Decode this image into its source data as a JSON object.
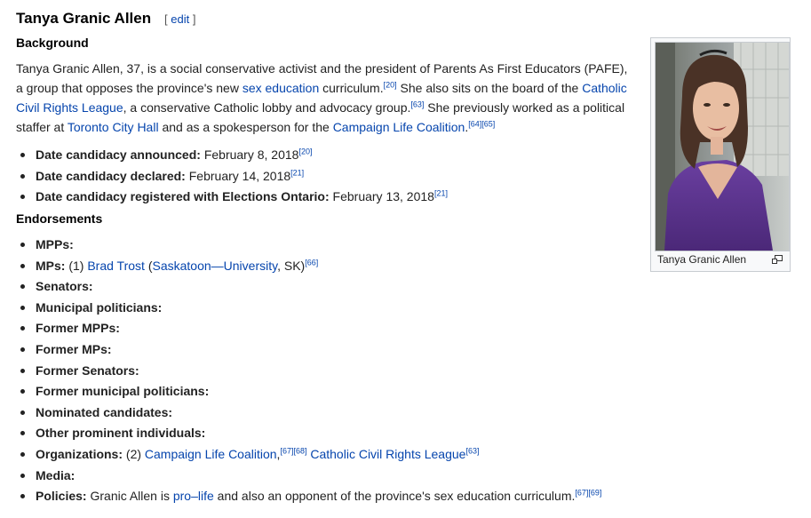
{
  "heading": {
    "title": "Tanya Granic Allen",
    "edit_open": "[",
    "edit_link": "edit",
    "edit_close": "]"
  },
  "background": {
    "heading": "Background",
    "p1": "Tanya Granic Allen, 37, is a social conservative activist and the president of Parents As First Educators (PAFE), a group that opposes the province's new ",
    "link_sex_ed": "sex education",
    "p2": " curriculum.",
    "ref1": "[20]",
    "p3": " She also sits on the board of the ",
    "link_ccrl": "Catholic Civil Rights League",
    "p4": ", a conservative Catholic lobby and advocacy group.",
    "ref2": "[63]",
    "p5": " She previously worked as a political staffer at ",
    "link_toronto": "Toronto City Hall",
    "p6": " and as a spokesperson for the ",
    "link_clc": "Campaign Life Coalition",
    "p7": ".",
    "ref3": "[64]",
    "ref4": "[65]"
  },
  "dates": [
    {
      "label": "Date candidacy announced:",
      "value": " February 8, 2018",
      "ref": "[20]"
    },
    {
      "label": "Date candidacy declared:",
      "value": " February 14, 2018",
      "ref": "[21]"
    },
    {
      "label": "Date candidacy registered with Elections Ontario:",
      "value": " February 13, 2018",
      "ref": "[21]"
    }
  ],
  "endorsements": {
    "heading": "Endorsements",
    "mpps": "MPPs:",
    "mps": {
      "label": "MPs:",
      "count": " (1) ",
      "link1": "Brad Trost",
      "paren_open": " (",
      "link2": "Saskatoon—University",
      "suffix": ", SK)",
      "ref": "[66]"
    },
    "senators": "Senators:",
    "municipal": "Municipal politicians:",
    "former_mpps": "Former MPPs:",
    "former_mps": "Former MPs:",
    "former_senators": "Former Senators:",
    "former_municipal": "Former municipal politicians:",
    "nominated": "Nominated candidates:",
    "other": "Other prominent individuals:",
    "orgs": {
      "label": "Organizations:",
      "count": " (2) ",
      "link1": "Campaign Life Coalition",
      "comma": ",",
      "ref1": "[67]",
      "ref2": "[68]",
      "space": " ",
      "link2": "Catholic Civil Rights League",
      "ref3": "[63]"
    },
    "media": "Media:",
    "policies": {
      "label": "Policies:",
      "text1": " Granic Allen is ",
      "link": "pro–life",
      "text2": " and also an opponent of the province's sex education curriculum.",
      "ref1": "[67]",
      "ref2": "[69]"
    }
  },
  "photo": {
    "caption": "Tanya Granic Allen",
    "icon": "magnify-icon"
  }
}
